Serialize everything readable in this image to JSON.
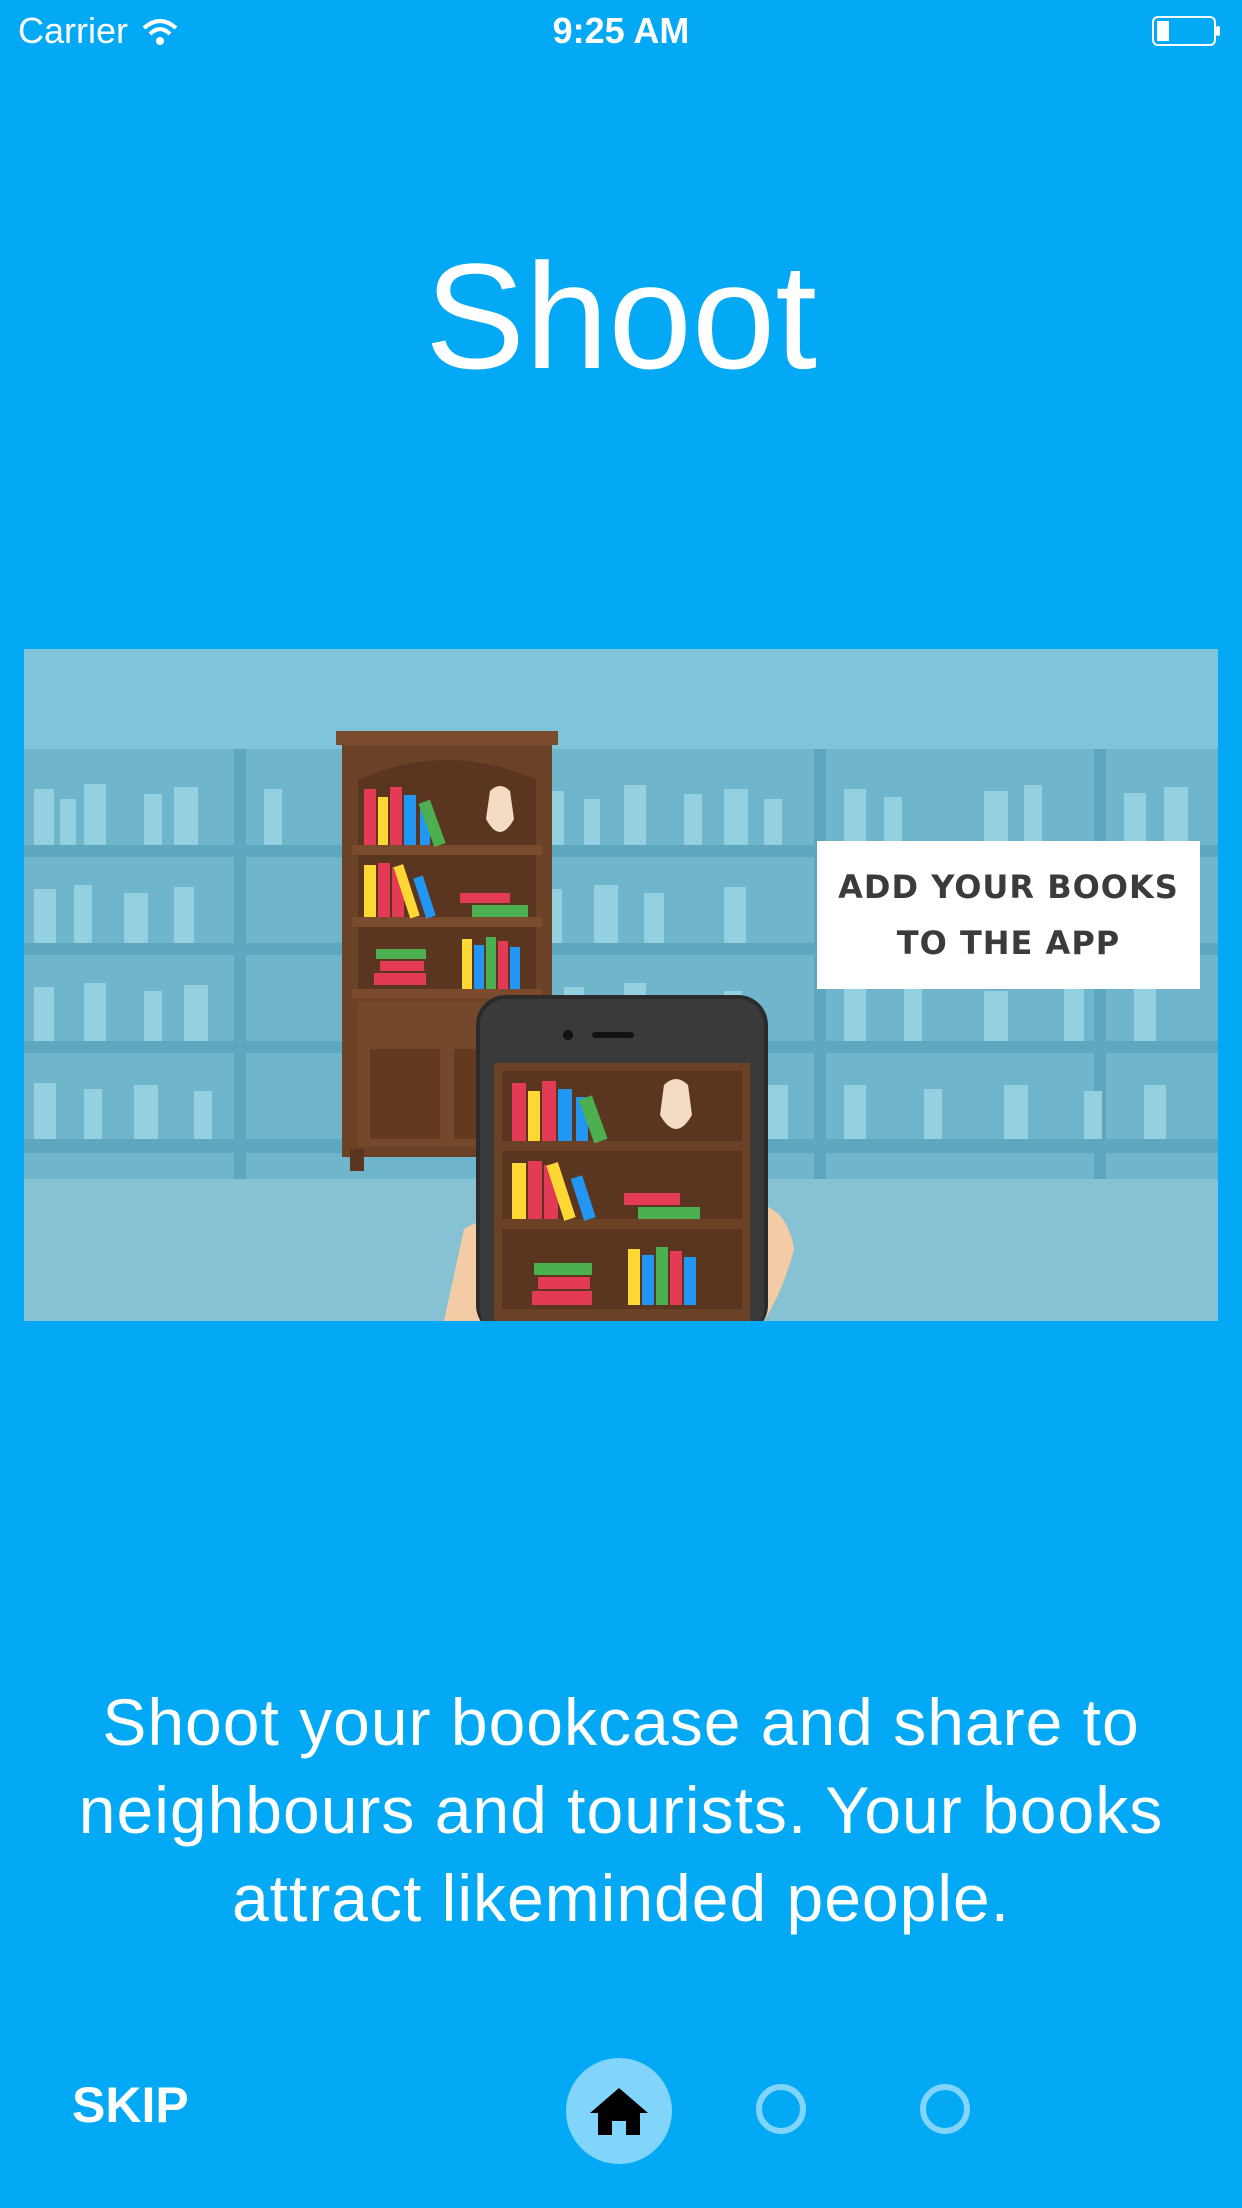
{
  "status_bar": {
    "carrier": "Carrier",
    "time": "9:25 AM",
    "icons": [
      "wifi-icon",
      "battery-icon"
    ]
  },
  "onboarding": {
    "title": "Shoot",
    "illustration": {
      "caption_line1": "ADD YOUR BOOKS",
      "caption_line2": "TO THE APP"
    },
    "description": "Shoot your bookcase and share to neighbours and tourists. Your books attract likeminded people."
  },
  "navigation": {
    "skip_label": "SKIP",
    "pages_total": 3,
    "current_page": 1,
    "active_icon": "home-icon"
  },
  "colors": {
    "background": "#03A9F4",
    "indicator": "#81D4FA"
  }
}
